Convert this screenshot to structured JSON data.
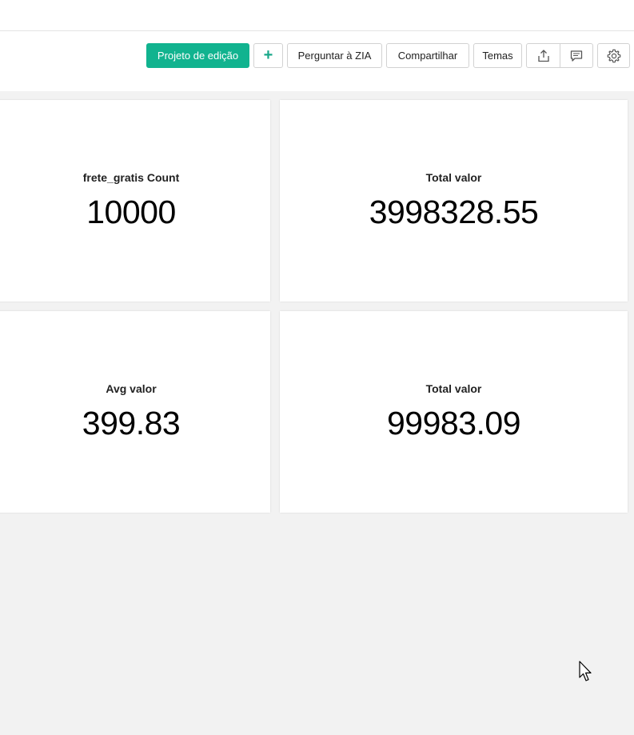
{
  "toolbar": {
    "edit_design_label": "Projeto de edição",
    "add_label": "+",
    "ask_zia_label": "Perguntar à ZIA",
    "share_label": "Compartilhar",
    "themes_label": "Temas",
    "icons": [
      "export-icon",
      "comment-icon",
      "gear-icon"
    ]
  },
  "widgets": [
    {
      "label": "frete_gratis Count",
      "value": "10000"
    },
    {
      "label": "Total valor",
      "value": "3998328.55"
    },
    {
      "label": "Avg valor",
      "value": "399.83"
    },
    {
      "label": "Total valor",
      "value": "99983.09"
    }
  ],
  "colors": {
    "primary": "#11b38f",
    "background": "#f2f2f2",
    "card": "#ffffff"
  }
}
